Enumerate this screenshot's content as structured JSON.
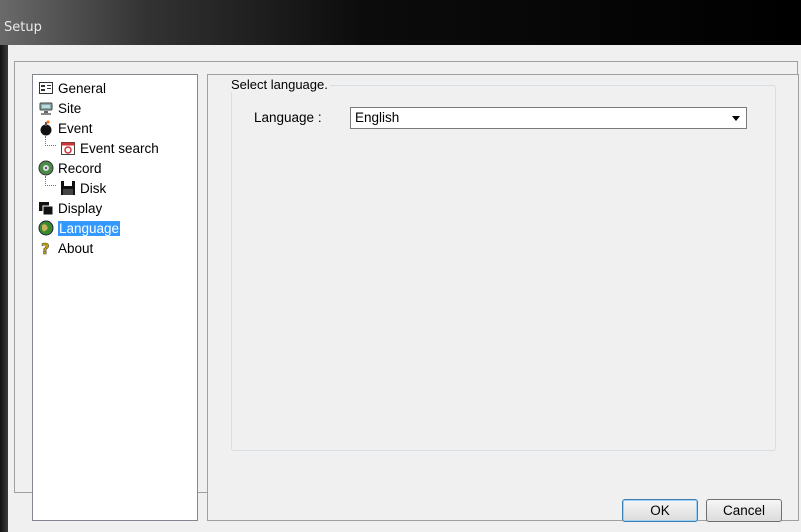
{
  "window": {
    "title": "Setup"
  },
  "tree": {
    "items": [
      {
        "label": "General",
        "icon": "general-icon"
      },
      {
        "label": "Site",
        "icon": "site-icon"
      },
      {
        "label": "Event",
        "icon": "event-icon"
      },
      {
        "label": "Event search",
        "icon": "event-search-icon"
      },
      {
        "label": "Record",
        "icon": "record-icon"
      },
      {
        "label": "Disk",
        "icon": "disk-icon"
      },
      {
        "label": "Display",
        "icon": "display-icon"
      },
      {
        "label": "Language",
        "icon": "language-icon",
        "selected": true
      },
      {
        "label": "About",
        "icon": "about-icon"
      }
    ]
  },
  "language_panel": {
    "group_title": "Select language.",
    "language_label": "Language :",
    "language_value": "English"
  },
  "buttons": {
    "ok": "OK",
    "cancel": "Cancel"
  },
  "colors": {
    "selection": "#3399ff",
    "titlebar": "#000000"
  }
}
